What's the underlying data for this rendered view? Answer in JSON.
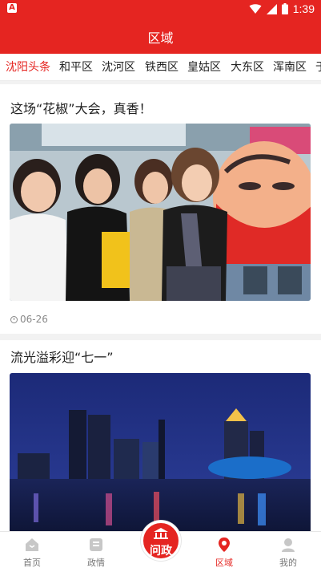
{
  "status_bar": {
    "left_icon": "A",
    "time": "1:39",
    "icons": [
      "wifi-icon",
      "signal-icon",
      "battery-icon"
    ]
  },
  "header": {
    "title": "区域"
  },
  "tabs": [
    {
      "label": "沈阳头条",
      "active": true
    },
    {
      "label": "和平区",
      "active": false
    },
    {
      "label": "沈河区",
      "active": false
    },
    {
      "label": "铁西区",
      "active": false
    },
    {
      "label": "皇姑区",
      "active": false
    },
    {
      "label": "大东区",
      "active": false
    },
    {
      "label": "浑南区",
      "active": false
    },
    {
      "label": "于",
      "active": false
    }
  ],
  "articles": [
    {
      "title": "这场“花椒”大会，真香！",
      "date": "06-26",
      "image": "expo-photo"
    },
    {
      "title": "流光溢彩迎“七一”",
      "image": "city-night-photo"
    }
  ],
  "bottom_nav": {
    "items": [
      {
        "label": "首页",
        "icon": "home-icon",
        "active": false
      },
      {
        "label": "政情",
        "icon": "news-icon",
        "active": false
      },
      {
        "label": "区域",
        "icon": "location-pin-icon",
        "active": true
      },
      {
        "label": "我的",
        "icon": "profile-icon",
        "active": false
      }
    ],
    "center": {
      "label": "问政",
      "icon": "gov-building-icon"
    }
  },
  "colors": {
    "brand_red": "#e52521"
  }
}
